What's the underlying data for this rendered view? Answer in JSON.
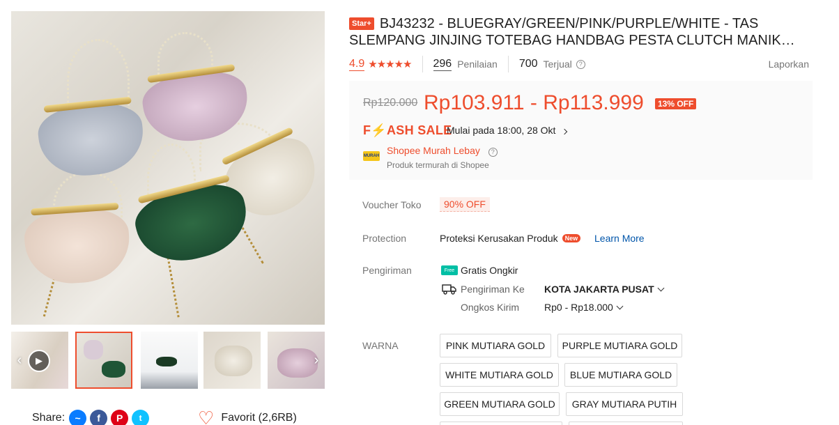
{
  "gallery": {
    "thumbnails": [
      {
        "name": "video-thumbnail",
        "has_play": true
      },
      {
        "name": "thumbnail-2",
        "selected": true
      },
      {
        "name": "thumbnail-3"
      },
      {
        "name": "thumbnail-4"
      },
      {
        "name": "thumbnail-5"
      }
    ]
  },
  "share": {
    "label": "Share:",
    "icons": [
      "messenger-icon",
      "facebook-icon",
      "pinterest-icon",
      "twitter-icon"
    ],
    "colors": {
      "messenger": "#0a7cff",
      "facebook": "#3b5999",
      "pinterest": "#de0217",
      "twitter": "#10c2ff"
    }
  },
  "favorite": {
    "label": "Favorit (2,6RB)"
  },
  "product": {
    "badge": "Star+",
    "title": "BJ43232 - BLUEGRAY/GREEN/PINK/PURPLE/WHITE - TAS SLEMPANG JINJING TOTEBAG HANDBAG PESTA CLUTCH MANIK…",
    "rating": "4.9",
    "stars": "★★★★★",
    "review_count": "296",
    "review_label": "Penilaian",
    "sold_count": "700",
    "sold_label": "Terjual",
    "report": "Laporkan"
  },
  "pricing": {
    "original": "Rp120.000",
    "current": "Rp103.911 - Rp113.999",
    "discount": "13% OFF",
    "flash_sale": "F⚡ASH SALE",
    "flash_time": "Mulai pada 18:00, 28 Okt",
    "murah_title": "Shopee Murah Lebay",
    "murah_sub": "Produk termurah di Shopee"
  },
  "details": {
    "voucher_label": "Voucher Toko",
    "voucher_value": "90% OFF",
    "protection_label": "Protection",
    "protection_value": "Proteksi Kerusakan Produk",
    "new_badge": "New",
    "learn_more": "Learn More",
    "shipping_label": "Pengiriman",
    "free_badge": "Free",
    "free_shipping": "Gratis Ongkir",
    "ship_to_label": "Pengiriman Ke",
    "ship_to_value": "KOTA JAKARTA PUSAT",
    "cost_label": "Ongkos Kirim",
    "cost_value": "Rp0 - Rp18.000"
  },
  "variants": {
    "label": "WARNA",
    "options": [
      "PINK MUTIARA GOLD",
      "PURPLE MUTIARA GOLD",
      "WHITE MUTIARA GOLD",
      "BLUE MUTIARA GOLD",
      "GREEN MUTIARA GOLD",
      "GRAY MUTIARA PUTIH"
    ]
  },
  "accent_color": "#ee4d2d"
}
